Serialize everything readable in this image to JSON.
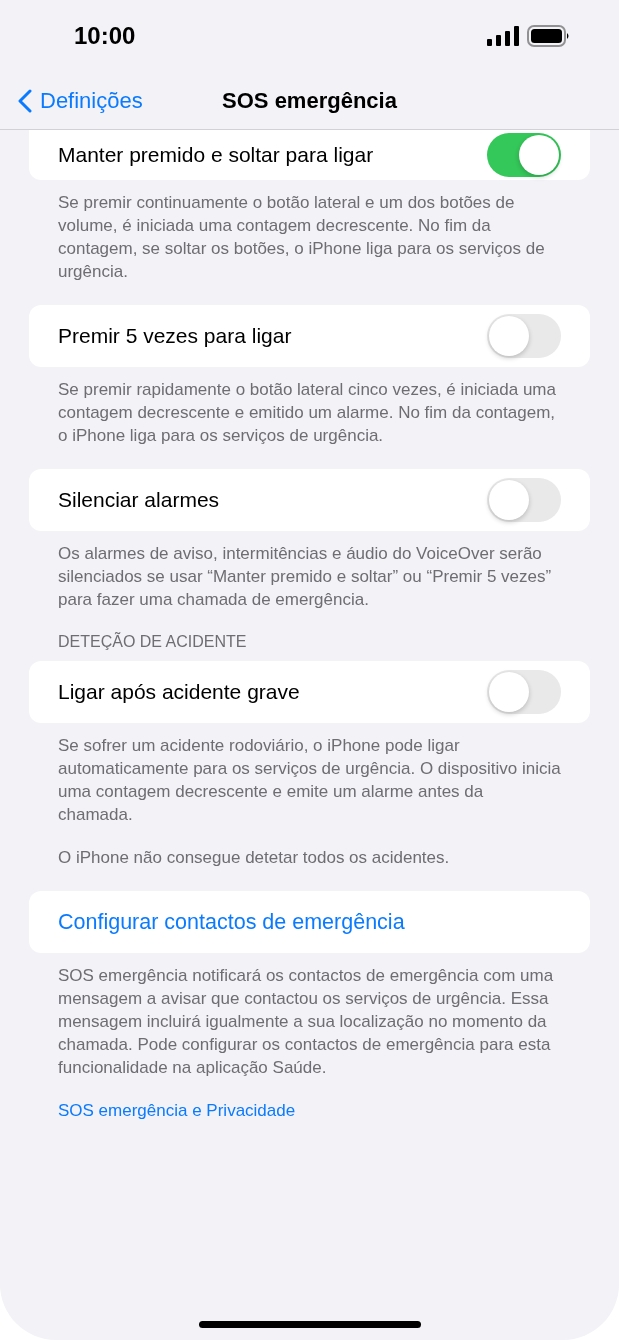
{
  "status_bar": {
    "time": "10:00"
  },
  "nav": {
    "back": "Definições",
    "title": "SOS emergência"
  },
  "sections": [
    {
      "rows": [
        {
          "kind": "toggle",
          "label": "Manter premido e soltar para ligar",
          "on": true
        }
      ],
      "footer": [
        "Se premir continuamente o botão lateral e um dos botões de volume, é iniciada uma contagem decrescente. No fim da contagem, se soltar os botões, o iPhone liga para os serviços de urgência."
      ]
    },
    {
      "rows": [
        {
          "kind": "toggle",
          "label": "Premir 5 vezes para ligar",
          "on": false
        }
      ],
      "footer": [
        "Se premir rapidamente o botão lateral cinco vezes, é iniciada uma contagem decrescente e emitido um alarme. No fim da contagem, o iPhone liga para os serviços de urgência."
      ]
    },
    {
      "rows": [
        {
          "kind": "toggle",
          "label": "Silenciar alarmes",
          "on": false
        }
      ],
      "footer": [
        "Os alarmes de aviso, intermitências e áudio do VoiceOver serão silenciados se usar “Manter premido e soltar” ou “Premir 5 vezes” para fazer uma chamada de emergência."
      ]
    },
    {
      "header": "DETEÇÃO DE ACIDENTE",
      "rows": [
        {
          "kind": "toggle",
          "label": "Ligar após acidente grave",
          "on": false
        }
      ],
      "footer": [
        "Se sofrer um acidente rodoviário, o iPhone pode ligar automaticamente para os serviços de urgência. O dispositivo inicia uma contagem decrescente e emite um alarme antes da chamada.",
        "O iPhone não consegue detetar todos os acidentes."
      ]
    },
    {
      "rows": [
        {
          "kind": "link",
          "label": "Configurar contactos de emergência"
        }
      ],
      "footer": [
        "SOS emergência notificará os contactos de emergência com uma mensagem a avisar que contactou os serviços de urgência. Essa mensagem incluirá igualmente a sua localização no momento da chamada. Pode configurar os contactos de emergência para esta funcionalidade na aplicação Saúde."
      ],
      "footer_link": "SOS emergência e Privacidade"
    }
  ]
}
